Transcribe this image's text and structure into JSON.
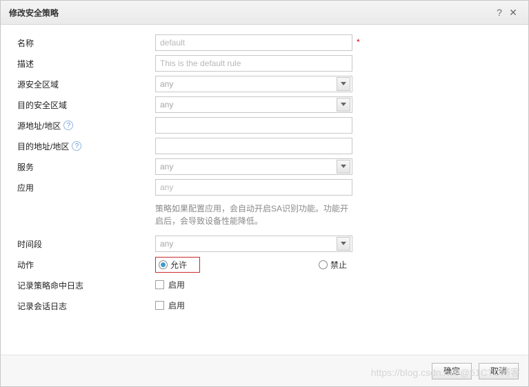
{
  "dialog": {
    "title": "修改安全策略"
  },
  "fields": {
    "name": {
      "label": "名称",
      "value": "default",
      "required": true
    },
    "desc": {
      "label": "描述",
      "value": "This is the default rule"
    },
    "src_zone": {
      "label": "源安全区域",
      "value": "any"
    },
    "dst_zone": {
      "label": "目的安全区域",
      "value": "any"
    },
    "src_addr": {
      "label": "源地址/地区",
      "value": ""
    },
    "dst_addr": {
      "label": "目的地址/地区",
      "value": ""
    },
    "service": {
      "label": "服务",
      "value": "any"
    },
    "app": {
      "label": "应用",
      "value": "any"
    },
    "app_tip": "策略如果配置应用，会自动开启SA识别功能。功能开启后，会导致设备性能降低。",
    "time": {
      "label": "时间段",
      "value": "any"
    },
    "action": {
      "label": "动作",
      "allow": "允许",
      "deny": "禁止",
      "selected": "allow"
    },
    "log_hit": {
      "label": "记录策略命中日志",
      "option": "启用",
      "checked": false
    },
    "log_sess": {
      "label": "记录会话日志",
      "option": "启用",
      "checked": false
    }
  },
  "buttons": {
    "ok": "确定",
    "cancel": "取消"
  },
  "watermark": "https://blog.csdn.net/@51CTO博客"
}
